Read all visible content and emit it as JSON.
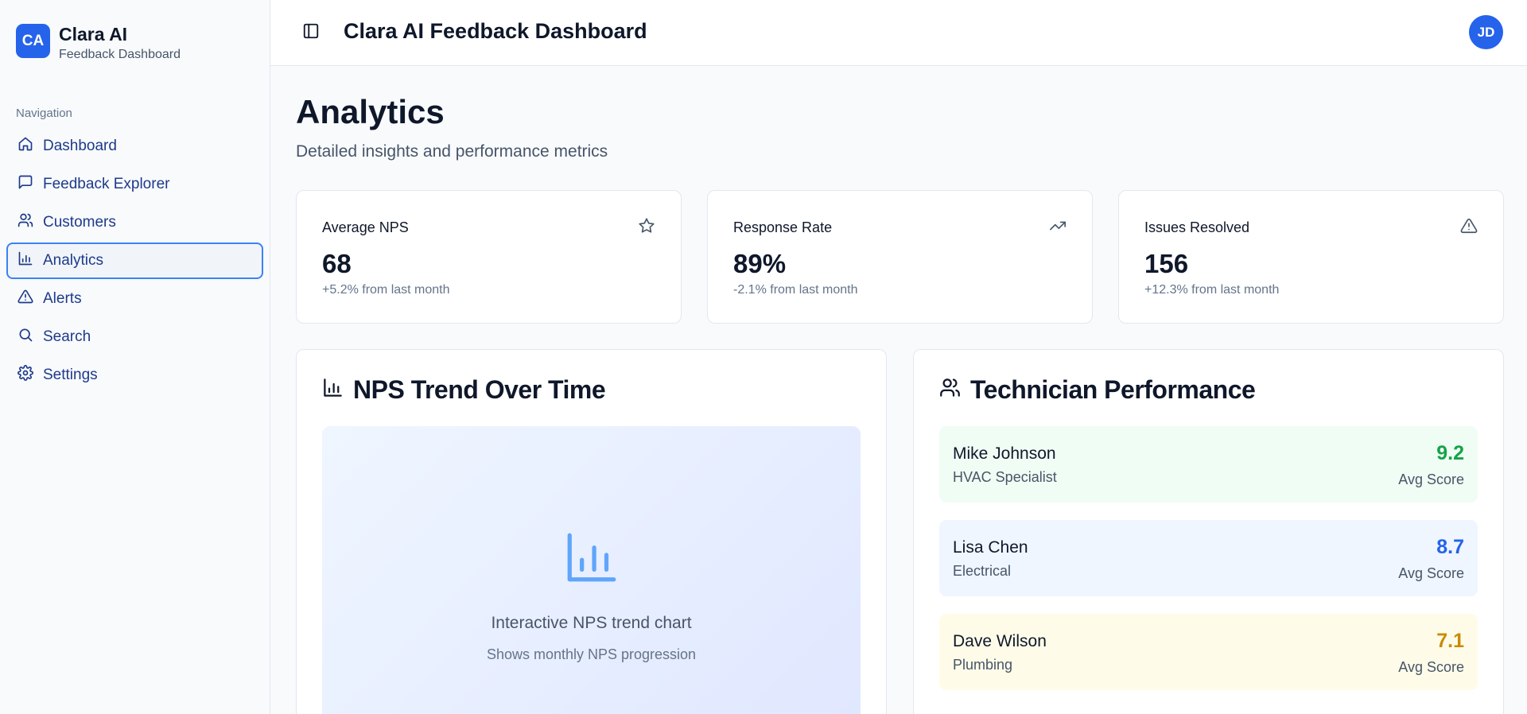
{
  "brand": {
    "initials": "CA",
    "name": "Clara AI",
    "subtitle": "Feedback Dashboard"
  },
  "sidebar": {
    "section_label": "Navigation",
    "items": [
      {
        "label": "Dashboard",
        "icon": "home-icon"
      },
      {
        "label": "Feedback Explorer",
        "icon": "message-icon"
      },
      {
        "label": "Customers",
        "icon": "users-icon"
      },
      {
        "label": "Analytics",
        "icon": "bar-chart-icon",
        "active": true
      },
      {
        "label": "Alerts",
        "icon": "alert-triangle-icon"
      },
      {
        "label": "Search",
        "icon": "search-icon"
      },
      {
        "label": "Settings",
        "icon": "gear-icon"
      }
    ]
  },
  "header": {
    "title": "Clara AI Feedback Dashboard",
    "avatar_initials": "JD"
  },
  "page": {
    "title": "Analytics",
    "subtitle": "Detailed insights and performance metrics"
  },
  "stats": [
    {
      "label": "Average NPS",
      "value": "68",
      "change": "+5.2% from last month",
      "icon": "star-icon"
    },
    {
      "label": "Response Rate",
      "value": "89%",
      "change": "-2.1% from last month",
      "icon": "trending-up-icon"
    },
    {
      "label": "Issues Resolved",
      "value": "156",
      "change": "+12.3% from last month",
      "icon": "alert-triangle-icon"
    }
  ],
  "nps_panel": {
    "title": "NPS Trend Over Time",
    "placeholder_caption": "Interactive NPS trend chart",
    "placeholder_sub": "Shows monthly NPS progression"
  },
  "tech_panel": {
    "title": "Technician Performance",
    "technicians": [
      {
        "name": "Mike Johnson",
        "role": "HVAC Specialist",
        "score": "9.2",
        "score_label": "Avg Score",
        "bg": "#f0fdf4",
        "color": "#16a34a"
      },
      {
        "name": "Lisa Chen",
        "role": "Electrical",
        "score": "8.7",
        "score_label": "Avg Score",
        "bg": "#eff6ff",
        "color": "#2563eb"
      },
      {
        "name": "Dave Wilson",
        "role": "Plumbing",
        "score": "7.1",
        "score_label": "Avg Score",
        "bg": "#fefce8",
        "color": "#ca8a04"
      }
    ]
  },
  "colors": {
    "accent": "#2563eb",
    "active_border": "#3b82f6",
    "nav_text": "#1e3a8a"
  }
}
